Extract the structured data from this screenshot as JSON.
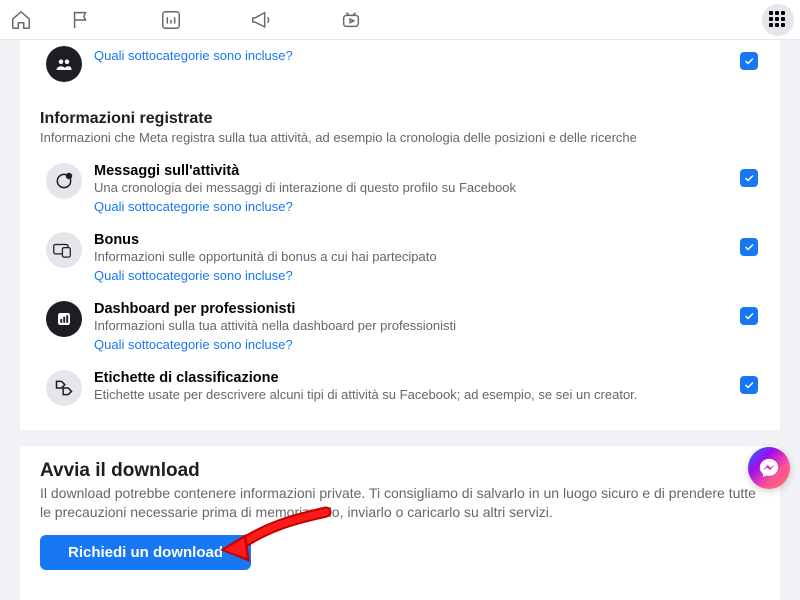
{
  "nav": {
    "home": "home-icon",
    "flag": "flag-icon",
    "dashboard": "dashboard-icon",
    "megaphone": "megaphone-icon",
    "video": "video-icon",
    "apps": "apps-grid-icon"
  },
  "subcat_link_text": "Quali sottocategorie sono incluse?",
  "partial_item": {
    "checked": true
  },
  "logged_section": {
    "title": "Informazioni registrate",
    "desc": "Informazioni che Meta registra sulla tua attività, ad esempio la cronologia delle posizioni e delle ricerche"
  },
  "items": [
    {
      "icon": "activity",
      "title": "Messaggi sull'attività",
      "desc": "Una cronologia dei messaggi di interazione di questo profilo su Facebook",
      "has_link": true,
      "checked": true
    },
    {
      "icon": "bonus",
      "title": "Bonus",
      "desc": "Informazioni sulle opportunità di bonus a cui hai partecipato",
      "has_link": true,
      "checked": true
    },
    {
      "icon": "prodash",
      "title": "Dashboard per professionisti",
      "desc": "Informazioni sulla tua attività nella dashboard per professionisti",
      "has_link": true,
      "checked": true
    },
    {
      "icon": "labels",
      "title": "Etichette di classificazione",
      "desc": "Etichette usate per descrivere alcuni tipi di attività su Facebook; ad esempio, se sei un creator.",
      "has_link": false,
      "checked": true
    }
  ],
  "download": {
    "title": "Avvia il download",
    "desc": "Il download potrebbe contenere informazioni private. Ti consigliamo di salvarlo in un luogo sicuro e di prendere tutte le precauzioni necessarie prima di memorizzarlo, inviarlo o caricarlo su altri servizi.",
    "button": "Richiedi un download"
  },
  "colors": {
    "accent": "#1877f2"
  }
}
